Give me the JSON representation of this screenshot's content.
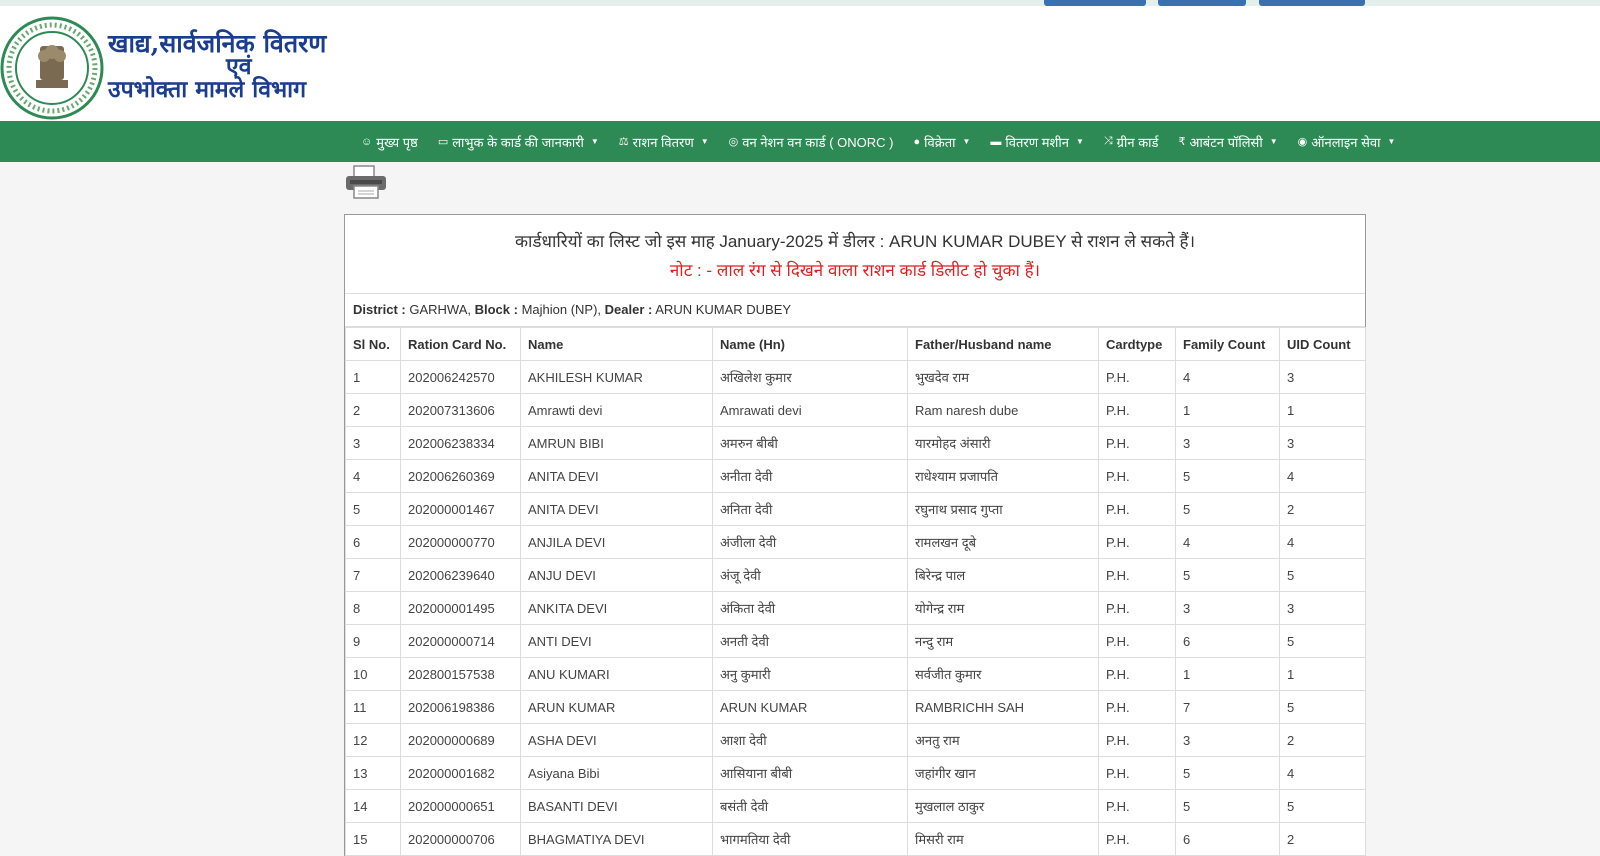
{
  "header": {
    "dept_line1": "खाद्य,सार्वजनिक वितरण",
    "dept_line2": "एवं",
    "dept_line3": "उपभोक्ता मामले विभाग",
    "logo_text_top": "झारखण्ड सरकार",
    "logo_text_bottom": "GOVERNMENT OF JHARKHAND"
  },
  "colors": {
    "navbar": "#2e8a55",
    "dept_text": "#1a3d8f",
    "note_red": "#e02020",
    "top_buttons": "#3a6fb0"
  },
  "nav": [
    {
      "label": "मुख्य पृष्ठ",
      "icon": "home-icon",
      "dropdown": false
    },
    {
      "label": "लाभुक के कार्ड की जानकारी",
      "icon": "card-icon",
      "dropdown": true
    },
    {
      "label": "राशन वितरण",
      "icon": "scale-icon",
      "dropdown": true
    },
    {
      "label": "वन नेशन वन कार्ड ( ONORC )",
      "icon": "circle-icon",
      "dropdown": false
    },
    {
      "label": "विक्रेता",
      "icon": "user-icon",
      "dropdown": true
    },
    {
      "label": "वितरण मशीन",
      "icon": "machine-icon",
      "dropdown": true
    },
    {
      "label": "ग्रीन कार्ड",
      "icon": "shuffle-icon",
      "dropdown": false
    },
    {
      "label": "आबंटन पॉलिसी",
      "icon": "rupee-icon",
      "dropdown": true
    },
    {
      "label": "ऑनलाइन सेवा",
      "icon": "globe-icon",
      "dropdown": true
    }
  ],
  "title": "कार्डधारियों का लिस्ट जो इस माह January-2025 में डीलर : ARUN KUMAR DUBEY से राशन ले सकते हैं।",
  "note": "नोट : - लाल रंग से दिखने वाला राशन कार्ड डिलीट हो चुका हैं।",
  "info": {
    "district_label": "District :",
    "district": " GARHWA,",
    "block_label": "Block :",
    "block": " Majhion (NP),",
    "dealer_label": "Dealer :",
    "dealer": " ARUN KUMAR DUBEY"
  },
  "table": {
    "headers": [
      "Sl No.",
      "Ration Card No.",
      "Name",
      "Name (Hn)",
      "Father/Husband name",
      "Cardtype",
      "Family Count",
      "UID Count"
    ],
    "rows": [
      [
        "1",
        "202006242570",
        "AKHILESH KUMAR",
        "अखिलेश कुमार",
        "भुखदेव राम",
        "P.H.",
        "4",
        "3"
      ],
      [
        "2",
        "202007313606",
        "Amrawti devi",
        "Amrawati devi",
        "Ram naresh dube",
        "P.H.",
        "1",
        "1"
      ],
      [
        "3",
        "202006238334",
        "AMRUN BIBI",
        "अमरुन बीबी",
        "यारमोहद अंसारी",
        "P.H.",
        "3",
        "3"
      ],
      [
        "4",
        "202006260369",
        "ANITA DEVI",
        "अनीता देवी",
        "राधेश्याम प्रजापति",
        "P.H.",
        "5",
        "4"
      ],
      [
        "5",
        "202000001467",
        "ANITA DEVI",
        "अनिता देवी",
        "रघुनाथ प्रसाद गुप्ता",
        "P.H.",
        "5",
        "2"
      ],
      [
        "6",
        "202000000770",
        "ANJILA DEVI",
        "अंजीला देवी",
        "रामलखन दूबे",
        "P.H.",
        "4",
        "4"
      ],
      [
        "7",
        "202006239640",
        "ANJU DEVI",
        "अंजू देवी",
        "बिरेन्द्र पाल",
        "P.H.",
        "5",
        "5"
      ],
      [
        "8",
        "202000001495",
        "ANKITA DEVI",
        "अंकिता देवी",
        "योगेन्द्र राम",
        "P.H.",
        "3",
        "3"
      ],
      [
        "9",
        "202000000714",
        "ANTI DEVI",
        "अनती देवी",
        "नन्दु राम",
        "P.H.",
        "6",
        "5"
      ],
      [
        "10",
        "202800157538",
        "ANU KUMARI",
        "अनु कुमारी",
        "सर्वजीत कुमार",
        "P.H.",
        "1",
        "1"
      ],
      [
        "11",
        "202006198386",
        "ARUN KUMAR",
        "ARUN KUMAR",
        "RAMBRICHH SAH",
        "P.H.",
        "7",
        "5"
      ],
      [
        "12",
        "202000000689",
        "ASHA DEVI",
        "आशा देवी",
        "अनतु राम",
        "P.H.",
        "3",
        "2"
      ],
      [
        "13",
        "202000001682",
        "Asiyana Bibi",
        "आसियाना बीबी",
        "जहांगीर खान",
        "P.H.",
        "5",
        "4"
      ],
      [
        "14",
        "202000000651",
        "BASANTI DEVI",
        "बसंती देवी",
        "मुखलाल ठाकुर",
        "P.H.",
        "5",
        "5"
      ],
      [
        "15",
        "202000000706",
        "BHAGMATIYA DEVI",
        "भागमतिया देवी",
        "मिसरी राम",
        "P.H.",
        "6",
        "2"
      ]
    ]
  }
}
